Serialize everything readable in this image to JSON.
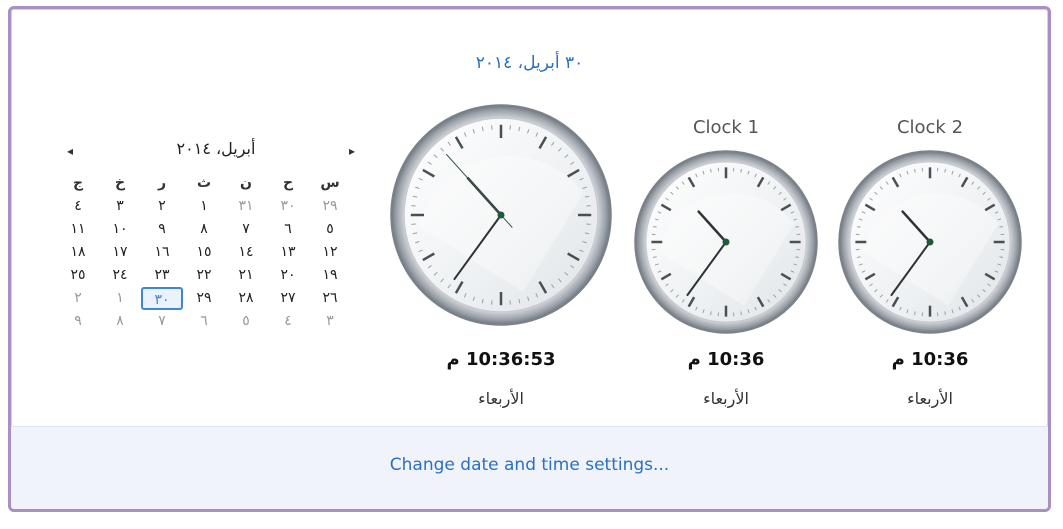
{
  "header": {
    "date": "٣٠ أبريل، ٢٠١٤"
  },
  "calendar": {
    "title": "أبريل، ٢٠١٤",
    "prev_icon": "◂",
    "next_icon": "▸",
    "weekdays": [
      "س",
      "ح",
      "ن",
      "ث",
      "ر",
      "خ",
      "ج"
    ],
    "weeks": [
      [
        "٢٩",
        "٣٠",
        "٣١",
        "١",
        "٢",
        "٣",
        "٤"
      ],
      [
        "٥",
        "٦",
        "٧",
        "٨",
        "٩",
        "١٠",
        "١١"
      ],
      [
        "١٢",
        "١٣",
        "١٤",
        "١٥",
        "١٦",
        "١٧",
        "١٨"
      ],
      [
        "١٩",
        "٢٠",
        "٢١",
        "٢٢",
        "٢٣",
        "٢٤",
        "٢٥"
      ],
      [
        "٢٦",
        "٢٧",
        "٢٨",
        "٢٩",
        "٣٠",
        "١",
        "٢"
      ],
      [
        "٣",
        "٤",
        "٥",
        "٦",
        "٧",
        "٨",
        "٩"
      ]
    ],
    "other_month": [
      [
        true,
        true,
        true,
        false,
        false,
        false,
        false
      ],
      [
        false,
        false,
        false,
        false,
        false,
        false,
        false
      ],
      [
        false,
        false,
        false,
        false,
        false,
        false,
        false
      ],
      [
        false,
        false,
        false,
        false,
        false,
        false,
        false
      ],
      [
        false,
        false,
        false,
        false,
        false,
        true,
        true
      ],
      [
        true,
        true,
        true,
        true,
        true,
        true,
        true
      ]
    ],
    "today": [
      4,
      4
    ]
  },
  "clocks": [
    {
      "label": "",
      "time": "10:36:53 م",
      "day": "الأربعاء",
      "hour": 10,
      "minute": 36,
      "second": 53
    },
    {
      "label": "Clock 1",
      "time": "10:36 م",
      "day": "الأربعاء",
      "hour": 10,
      "minute": 36,
      "second": null
    },
    {
      "label": "Clock 2",
      "time": "10:36 م",
      "day": "الأربعاء",
      "hour": 10,
      "minute": 36,
      "second": null
    }
  ],
  "footer": {
    "link": "Change date and time settings..."
  }
}
